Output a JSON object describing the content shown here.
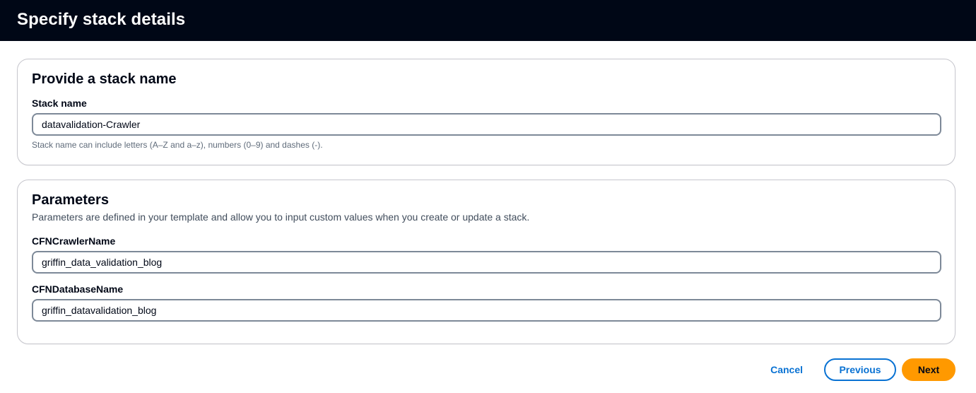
{
  "header": {
    "title": "Specify stack details"
  },
  "stack_section": {
    "title": "Provide a stack name",
    "stack_name_label": "Stack name",
    "stack_name_value": "datavalidation-Crawler",
    "stack_name_hint": "Stack name can include letters (A–Z and a–z), numbers (0–9) and dashes (-)."
  },
  "parameters_section": {
    "title": "Parameters",
    "description": "Parameters are defined in your template and allow you to input custom values when you create or update a stack.",
    "params": [
      {
        "label": "CFNCrawlerName",
        "value": "griffin_data_validation_blog"
      },
      {
        "label": "CFNDatabaseName",
        "value": "griffin_datavalidation_blog"
      }
    ]
  },
  "actions": {
    "cancel_label": "Cancel",
    "previous_label": "Previous",
    "next_label": "Next"
  },
  "colors": {
    "header_bg": "#000716",
    "link_blue": "#0972d3",
    "primary_orange": "#ff9900"
  }
}
